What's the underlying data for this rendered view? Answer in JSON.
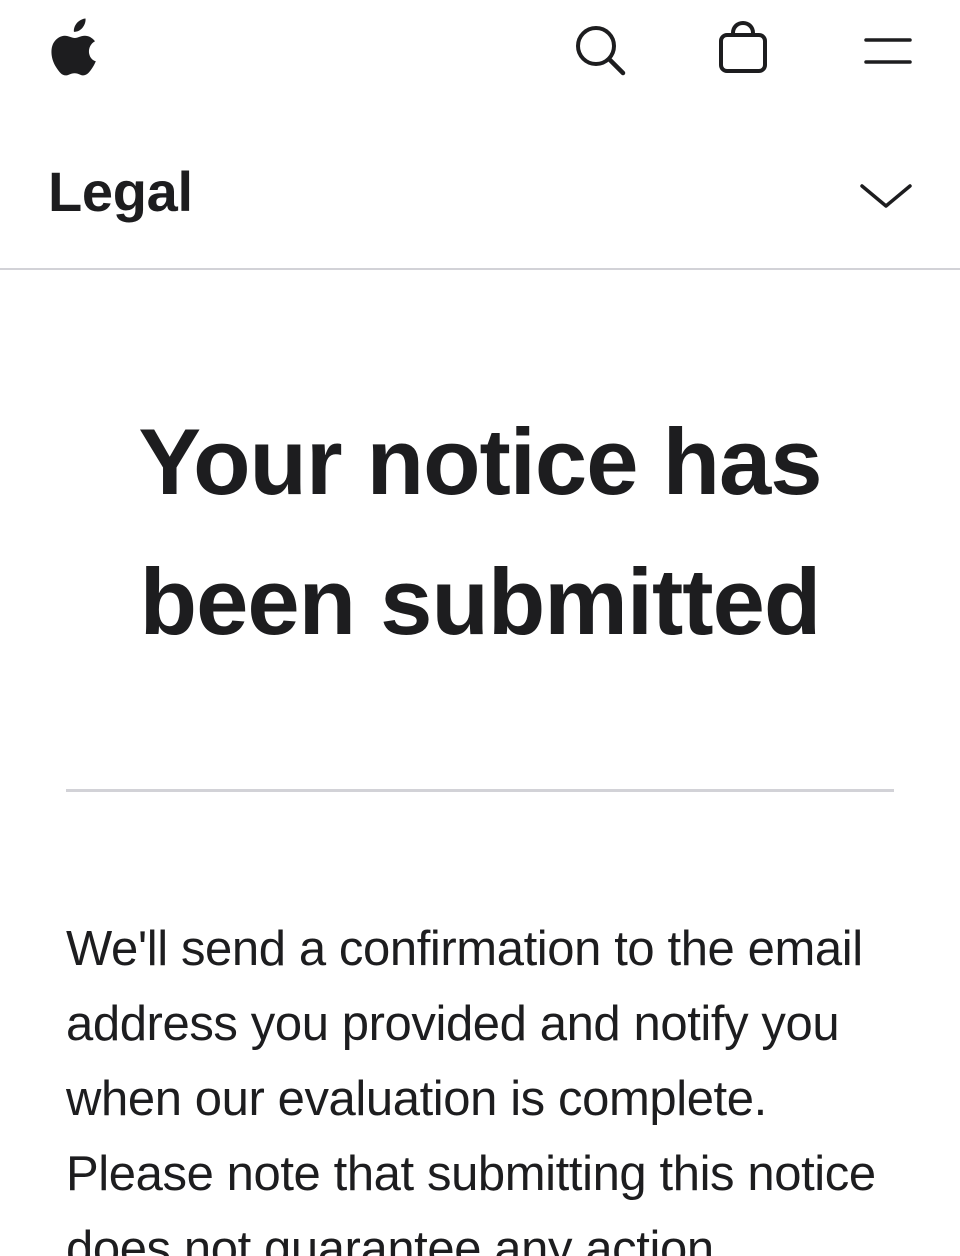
{
  "globalnav": {
    "logo_icon": "apple-logo-icon",
    "search_icon": "search-icon",
    "bag_icon": "shopping-bag-icon",
    "menu_icon": "menu-icon"
  },
  "localnav": {
    "title": "Legal",
    "toggle_icon": "chevron-down-icon"
  },
  "main": {
    "heading": "Your notice has been submitted",
    "body": "We'll send a confirmation to the email address you provided and notify you when our evaluation is complete. Please note that submitting this notice does not guarantee any action"
  },
  "colors": {
    "text": "#1d1d1f",
    "divider": "#d2d2d7",
    "background": "#ffffff"
  }
}
